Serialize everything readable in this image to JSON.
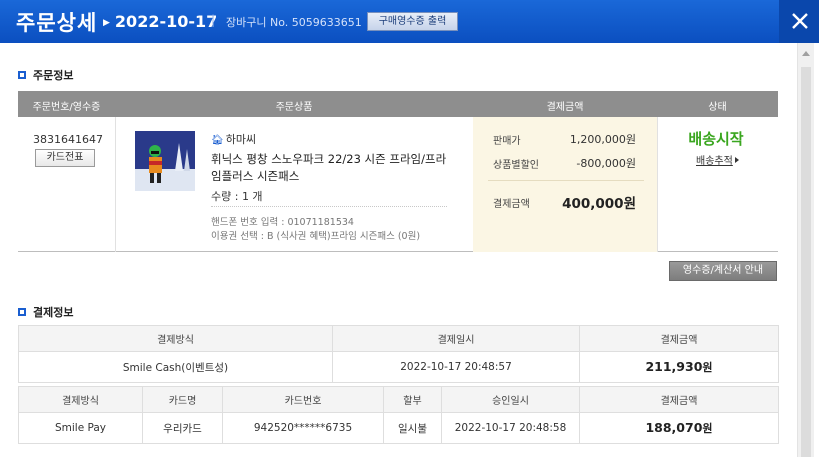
{
  "header": {
    "title": "주문상세",
    "date": "2022-10-17",
    "separator": "|",
    "cart_no": "장바구니 No. 5059633651",
    "print_button": "구매영수증 출력"
  },
  "order_section": {
    "title": "주문정보",
    "columns": [
      "주문번호/영수증",
      "주문상품",
      "결제금액",
      "상태"
    ],
    "order_no": "3831641647",
    "card_slip_button": "카드전표",
    "seller": "하마씨",
    "product_name": "휘닉스 평창 스노우파크 22/23 시즌 프라임/프라임플러스 시즌패스",
    "quantity": "수량 : 1 개",
    "phone": "핸드폰 번호 입력 : 01071181534",
    "voucher": "이용권 선택 : B (식사권 혜택)프라임 시즌패스 (0원)",
    "price_label": "판매가",
    "price_value": "1,200,000원",
    "discount_label": "상품별할인",
    "discount_value": "-800,000원",
    "paid_label": "결제금액",
    "paid_value": "400,000원",
    "status": "배송시작",
    "tracking": "배송추적"
  },
  "receipt_button": "영수증/계산서 안내",
  "payment_section": {
    "title": "결제정보",
    "table1": {
      "headers": [
        "결제방식",
        "결제일시",
        "결제금액"
      ],
      "row": {
        "method": "Smile Cash(이벤트성)",
        "datetime": "2022-10-17 20:48:57",
        "amount": "211,930",
        "unit": "원"
      }
    },
    "table2": {
      "headers": [
        "결제방식",
        "카드명",
        "카드번호",
        "할부",
        "승인일시",
        "결제금액"
      ],
      "row": {
        "method": "Smile Pay",
        "card_name": "우리카드",
        "card_no": "942520******6735",
        "installment": "일시불",
        "approved": "2022-10-17 20:48:58",
        "amount": "188,070",
        "unit": "원"
      }
    }
  },
  "colors": {
    "header_blue": "#0b4fc0",
    "status_green": "#3aa61f",
    "accent_square": "#1a5ed0"
  },
  "icons": [
    "close-icon",
    "home-icon",
    "arrow-right-icon",
    "scroll-up-arrow-icon"
  ]
}
